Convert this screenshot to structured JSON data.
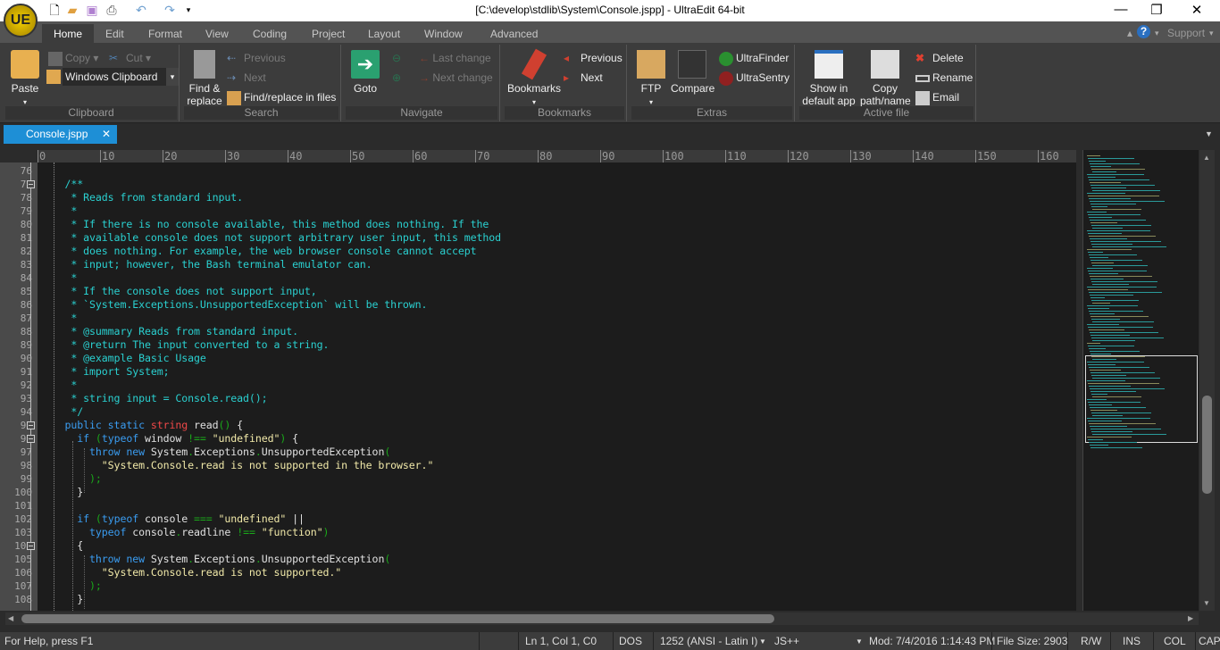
{
  "window": {
    "title": "[C:\\develop\\stdlib\\System\\Console.jspp] - UltraEdit 64-bit",
    "logo": "UE"
  },
  "ribbon_tabs": [
    "Home",
    "Edit",
    "Format",
    "View",
    "Coding",
    "Project",
    "Layout",
    "Window",
    "Advanced"
  ],
  "support": "Support",
  "clipboard": {
    "paste": "Paste",
    "copy": "Copy",
    "cut": "Cut",
    "clipboard_select": "Windows Clipboard",
    "label": "Clipboard"
  },
  "search": {
    "find": "Find &",
    "replace": "replace",
    "previous": "Previous",
    "next": "Next",
    "find_in_files": "Find/replace in files",
    "label": "Search"
  },
  "navigate": {
    "goto": "Goto",
    "last_change": "Last change",
    "next_change": "Next change",
    "label": "Navigate"
  },
  "bookmarks": {
    "bookmarks": "Bookmarks",
    "previous": "Previous",
    "next": "Next",
    "label": "Bookmarks"
  },
  "extras": {
    "ftp": "FTP",
    "compare": "Compare",
    "ultrafinder": "UltraFinder",
    "ultrasentry": "UltraSentry",
    "label": "Extras"
  },
  "active_file": {
    "show1": "Show in",
    "show2": "default app",
    "copy1": "Copy",
    "copy2": "path/name",
    "delete": "Delete",
    "rename": "Rename",
    "email": "Email",
    "label": "Active file"
  },
  "file_tab": {
    "name": "Console.jspp"
  },
  "ruler": [
    "0",
    "10",
    "20",
    "30",
    "40",
    "50",
    "60",
    "70",
    "80",
    "90",
    "100",
    "110",
    "120",
    "130",
    "140",
    "150",
    "160"
  ],
  "code_lines": [
    {
      "n": "76",
      "t": []
    },
    {
      "n": "77",
      "f": 1,
      "t": [
        [
          "c",
          "    /**"
        ]
      ]
    },
    {
      "n": "78",
      "t": [
        [
          "c",
          "     * Reads from standard input."
        ]
      ]
    },
    {
      "n": "79",
      "t": [
        [
          "c",
          "     *"
        ]
      ]
    },
    {
      "n": "80",
      "t": [
        [
          "c",
          "     * If there is no console available, this method does nothing. If the"
        ]
      ]
    },
    {
      "n": "81",
      "t": [
        [
          "c",
          "     * available console does not support arbitrary user input, this method"
        ]
      ]
    },
    {
      "n": "82",
      "t": [
        [
          "c",
          "     * does nothing. For example, the web browser console cannot accept"
        ]
      ]
    },
    {
      "n": "83",
      "t": [
        [
          "c",
          "     * input; however, the Bash terminal emulator can."
        ]
      ]
    },
    {
      "n": "84",
      "t": [
        [
          "c",
          "     *"
        ]
      ]
    },
    {
      "n": "85",
      "t": [
        [
          "c",
          "     * If the console does not support input,"
        ]
      ]
    },
    {
      "n": "86",
      "t": [
        [
          "c",
          "     * `System.Exceptions.UnsupportedException` will be thrown."
        ]
      ]
    },
    {
      "n": "87",
      "t": [
        [
          "c",
          "     *"
        ]
      ]
    },
    {
      "n": "88",
      "t": [
        [
          "c",
          "     * @summary Reads from standard input."
        ]
      ]
    },
    {
      "n": "89",
      "t": [
        [
          "c",
          "     * @return The input converted to a string."
        ]
      ]
    },
    {
      "n": "90",
      "t": [
        [
          "c",
          "     * @example Basic Usage"
        ]
      ]
    },
    {
      "n": "91",
      "t": [
        [
          "c",
          "     * import System;"
        ]
      ]
    },
    {
      "n": "92",
      "t": [
        [
          "c",
          "     *"
        ]
      ]
    },
    {
      "n": "93",
      "t": [
        [
          "c",
          "     * string input = Console.read();"
        ]
      ]
    },
    {
      "n": "94",
      "t": [
        [
          "c",
          "     */"
        ]
      ]
    },
    {
      "n": "95",
      "f": 1,
      "t": [
        [
          "k",
          "    public static "
        ],
        [
          "t",
          "string"
        ],
        [
          "i",
          " read"
        ],
        [
          "p",
          "()"
        ],
        [
          "i",
          " {"
        ]
      ]
    },
    {
      "n": "96",
      "f": 1,
      "t": [
        [
          "k",
          "      if "
        ],
        [
          "p",
          "("
        ],
        [
          "k",
          "typeof"
        ],
        [
          "i",
          " window "
        ],
        [
          "p",
          "!=="
        ],
        [
          "s",
          " \"undefined\""
        ],
        [
          "p",
          ")"
        ],
        [
          "i",
          " {"
        ]
      ]
    },
    {
      "n": "97",
      "t": [
        [
          "k",
          "        throw new "
        ],
        [
          "i",
          "System"
        ],
        [
          "p",
          "."
        ],
        [
          "i",
          "Exceptions"
        ],
        [
          "p",
          "."
        ],
        [
          "i",
          "UnsupportedException"
        ],
        [
          "p",
          "("
        ]
      ]
    },
    {
      "n": "98",
      "t": [
        [
          "s",
          "          \"System.Console.read is not supported in the browser.\""
        ]
      ]
    },
    {
      "n": "99",
      "t": [
        [
          "p",
          "        );"
        ]
      ]
    },
    {
      "n": "100",
      "t": [
        [
          "i",
          "      }"
        ]
      ]
    },
    {
      "n": "101",
      "t": []
    },
    {
      "n": "102",
      "t": [
        [
          "k",
          "      if "
        ],
        [
          "p",
          "("
        ],
        [
          "k",
          "typeof"
        ],
        [
          "i",
          " console "
        ],
        [
          "p",
          "==="
        ],
        [
          "s",
          " \"undefined\""
        ],
        [
          "i",
          " ||"
        ]
      ]
    },
    {
      "n": "103",
      "t": [
        [
          "k",
          "        typeof"
        ],
        [
          "i",
          " console"
        ],
        [
          "p",
          "."
        ],
        [
          "i",
          "readline "
        ],
        [
          "p",
          "!=="
        ],
        [
          "s",
          " \"function\""
        ],
        [
          "p",
          ")"
        ]
      ]
    },
    {
      "n": "104",
      "f": 1,
      "t": [
        [
          "i",
          "      {"
        ]
      ]
    },
    {
      "n": "105",
      "t": [
        [
          "k",
          "        throw new "
        ],
        [
          "i",
          "System"
        ],
        [
          "p",
          "."
        ],
        [
          "i",
          "Exceptions"
        ],
        [
          "p",
          "."
        ],
        [
          "i",
          "UnsupportedException"
        ],
        [
          "p",
          "("
        ]
      ]
    },
    {
      "n": "106",
      "t": [
        [
          "s",
          "          \"System.Console.read is not supported.\""
        ]
      ]
    },
    {
      "n": "107",
      "t": [
        [
          "p",
          "        );"
        ]
      ]
    },
    {
      "n": "108",
      "t": [
        [
          "i",
          "      }"
        ]
      ]
    }
  ],
  "status": {
    "help": "For Help, press F1",
    "position": "Ln 1, Col 1, C0",
    "line_ending": "DOS",
    "encoding": "1252  (ANSI - Latin I)",
    "language": "JS++",
    "modified": "Mod: 7/4/2016 1:14:43 PM",
    "file_size": "File Size: 2903",
    "rw": "R/W",
    "ins": "INS",
    "col": "COL",
    "cap": "CAP"
  }
}
